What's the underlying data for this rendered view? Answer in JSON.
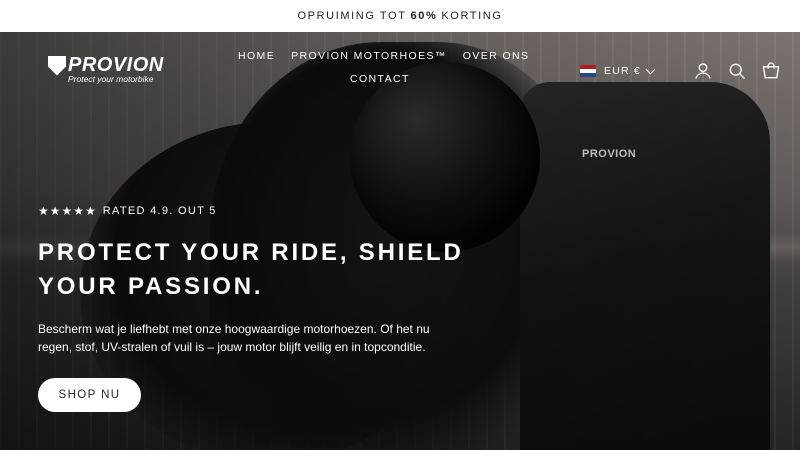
{
  "announcement": {
    "prefix": "OPRUIMING TOT",
    "highlight": "60%",
    "suffix": "KORTING"
  },
  "brand": {
    "name": "PROVION",
    "tagline": "Protect your motorbike"
  },
  "nav": {
    "items": [
      {
        "label": "HOME"
      },
      {
        "label": "PROVION MOTORHOES™"
      },
      {
        "label": "OVER ONS"
      },
      {
        "label": "CONTACT"
      }
    ]
  },
  "header_actions": {
    "currency": "EUR €",
    "flag_colors": [
      "#ae1c28",
      "#ffffff",
      "#21468b"
    ],
    "icons": [
      "account-icon",
      "search-icon",
      "cart-icon"
    ]
  },
  "hero": {
    "stars": "★★★★★",
    "rating_text": "RATED 4.9. OUT 5",
    "headline_line1": "PROTECT YOUR RIDE, SHIELD",
    "headline_line2": "YOUR PASSION.",
    "description": "Bescherm wat je liefhebt met onze hoogwaardige motorhoezen. Of het nu regen, stof, UV-stralen of vuil is – jouw motor blijft veilig en in topconditie.",
    "cta_label": "SHOP NU",
    "cover_brand": "PROVION"
  }
}
